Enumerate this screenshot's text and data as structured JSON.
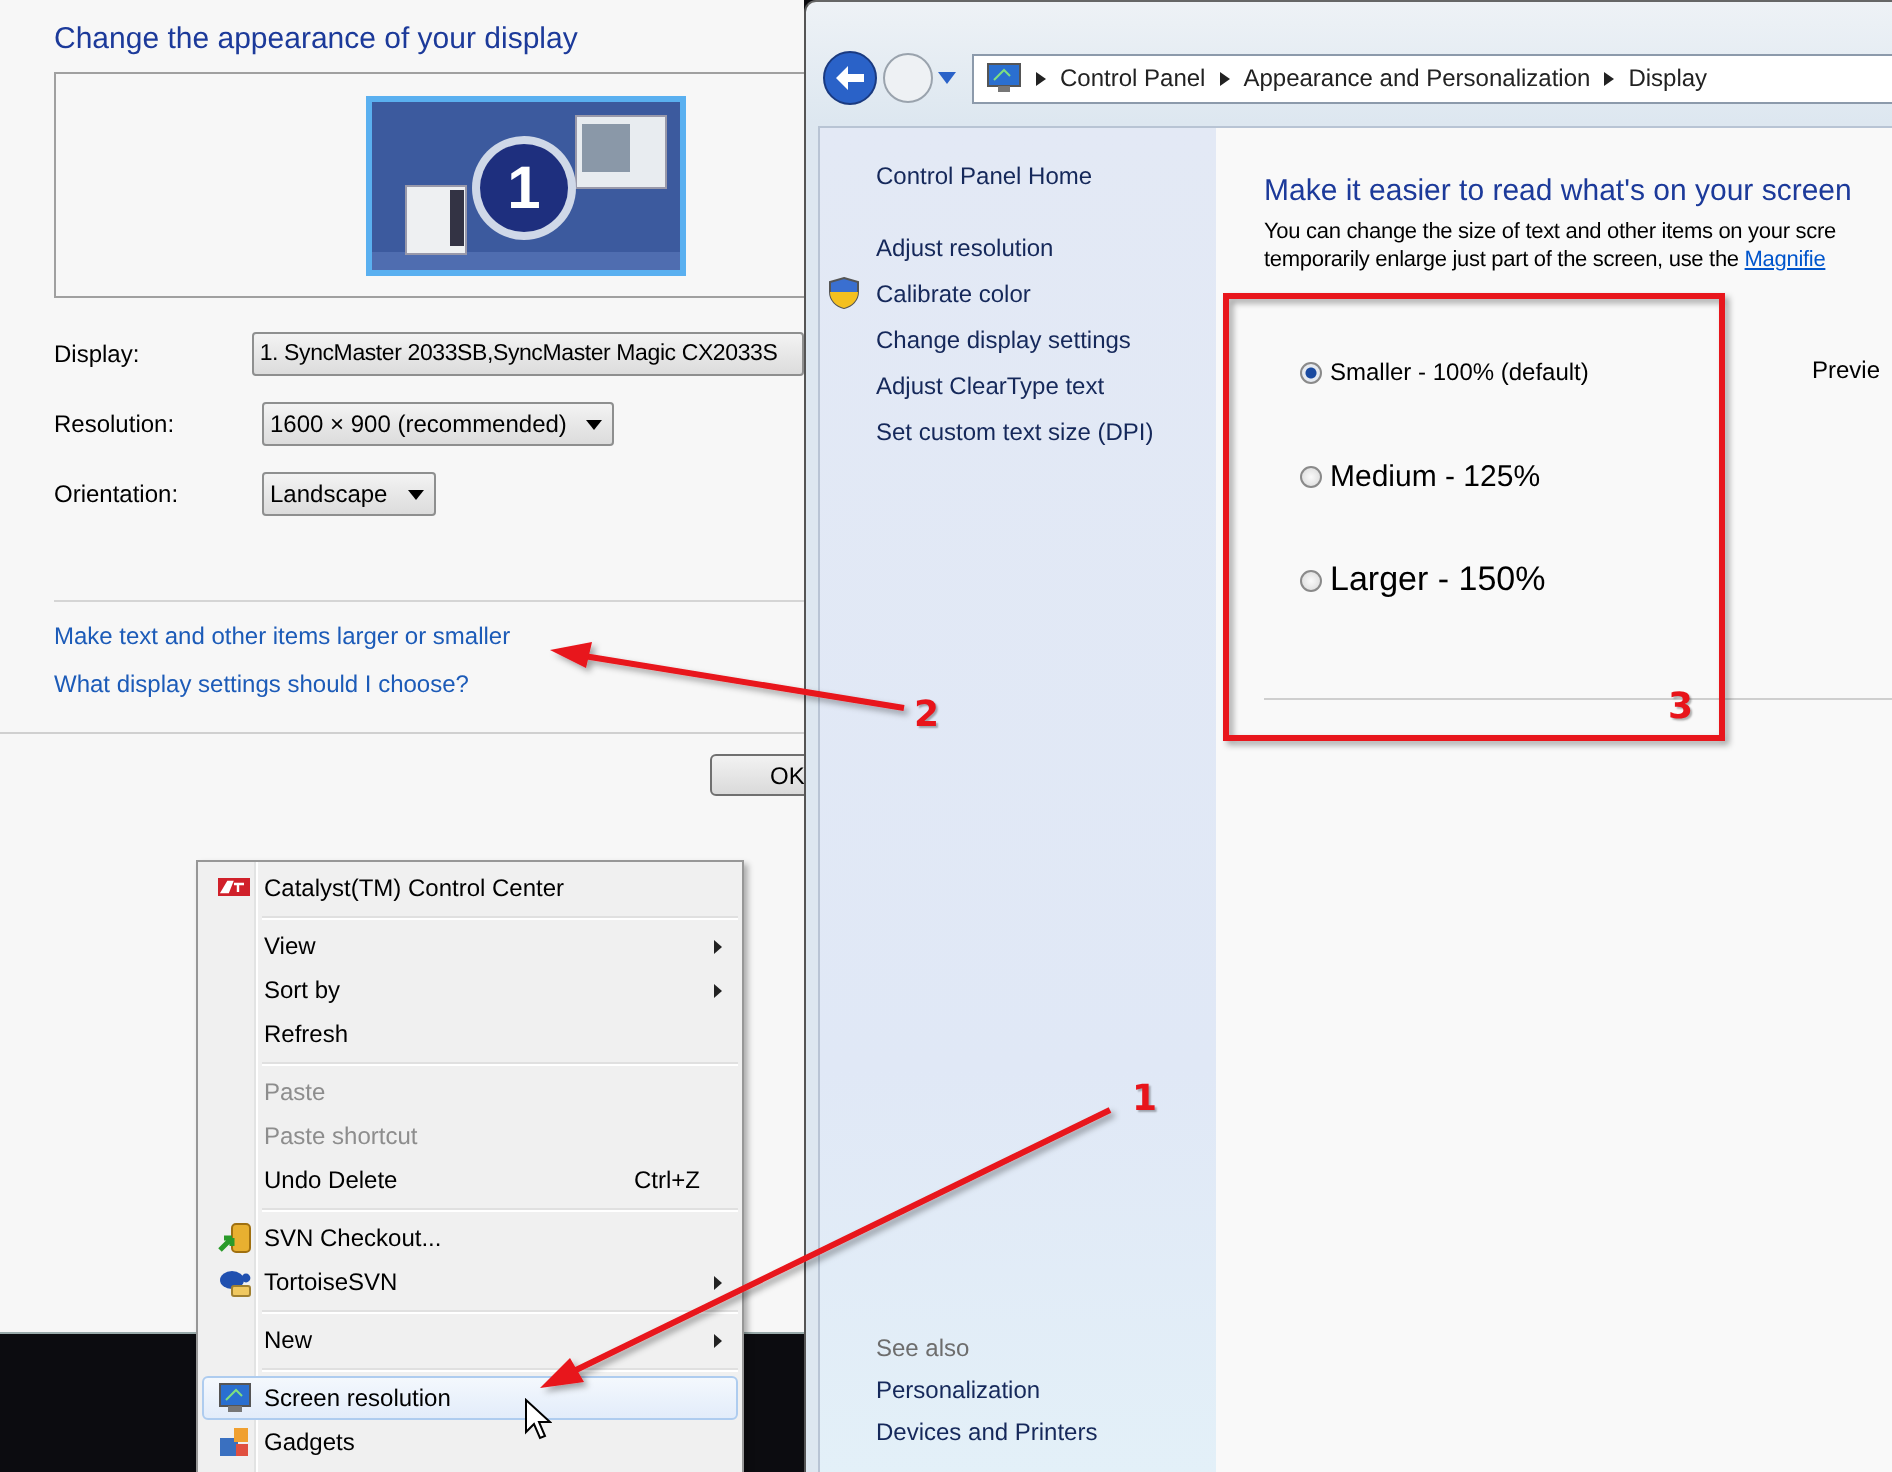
{
  "display_window": {
    "title": "Change the appearance of your display",
    "monitor_number": "1",
    "fields": [
      {
        "label": "Display:",
        "value": "1. SyncMaster 2033SB,SyncMaster Magic CX2033S",
        "kind": "wide"
      },
      {
        "label": "Resolution:",
        "value": "1600 × 900 (recommended)",
        "kind": "dropdown"
      },
      {
        "label": "Orientation:",
        "value": "Landscape",
        "kind": "dropdown"
      }
    ],
    "links": [
      "Make text and other items larger or smaller",
      "What display settings should I choose?"
    ],
    "buttons": [
      "OK"
    ]
  },
  "control_panel": {
    "breadcrumb": [
      "Control Panel",
      "Appearance and Personalization",
      "Display"
    ],
    "nav": [
      {
        "label": "Control Panel Home",
        "kind": "home"
      },
      {
        "label": "Adjust resolution",
        "kind": "task"
      },
      {
        "label": "Calibrate color",
        "kind": "admin"
      },
      {
        "label": "Change display settings",
        "kind": "task"
      },
      {
        "label": "Adjust ClearType text",
        "kind": "task"
      },
      {
        "label": "Set custom text size (DPI)",
        "kind": "task"
      }
    ],
    "see_also": {
      "title": "See also",
      "links": [
        "Personalization",
        "Devices and Printers"
      ]
    },
    "heading": "Make it easier to read what's on your screen",
    "description": [
      "You can change the size of text and other items on your scre",
      "temporarily enlarge just part of the screen, use the"
    ],
    "description_link": "Magnifie",
    "options": [
      {
        "label": "Smaller - 100% (default)",
        "selected": true,
        "kind": "small"
      },
      {
        "label": "Medium - 125%",
        "selected": false,
        "kind": "medium"
      },
      {
        "label": "Larger - 150%",
        "selected": false,
        "kind": "large"
      }
    ],
    "preview_label": "Previe"
  },
  "context_menu": {
    "groups": [
      [
        {
          "label": "Catalyst(TM) Control Center",
          "submenu": false,
          "disabled": false,
          "selected": false
        }
      ],
      [
        {
          "label": "View",
          "submenu": true,
          "disabled": false,
          "selected": false
        },
        {
          "label": "Sort by",
          "submenu": true,
          "disabled": false,
          "selected": false
        },
        {
          "label": "Refresh",
          "submenu": false,
          "disabled": false,
          "selected": false
        }
      ],
      [
        {
          "label": "Paste",
          "submenu": false,
          "disabled": true,
          "selected": false
        },
        {
          "label": "Paste shortcut",
          "submenu": false,
          "disabled": true,
          "selected": false
        },
        {
          "label": "Undo Delete",
          "shortcut": "Ctrl+Z",
          "submenu": false,
          "disabled": false,
          "selected": false
        }
      ],
      [
        {
          "label": "SVN Checkout...",
          "submenu": false,
          "disabled": false,
          "selected": false
        },
        {
          "label": "TortoiseSVN",
          "submenu": true,
          "disabled": false,
          "selected": false
        }
      ],
      [
        {
          "label": "New",
          "submenu": true,
          "disabled": false,
          "selected": false
        }
      ],
      [
        {
          "label": "Screen resolution",
          "submenu": false,
          "disabled": false,
          "selected": true
        },
        {
          "label": "Gadgets",
          "submenu": false,
          "disabled": false,
          "selected": false
        }
      ]
    ]
  },
  "annotations": [
    {
      "label": "1"
    },
    {
      "label": "2"
    },
    {
      "label": "3"
    }
  ]
}
